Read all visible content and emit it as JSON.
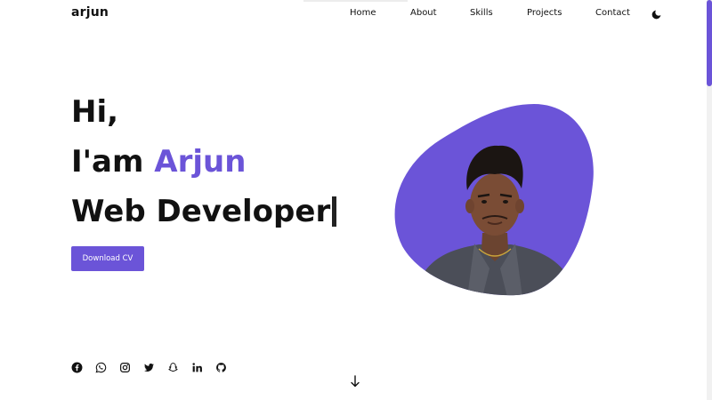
{
  "header": {
    "logo": "arjun",
    "nav": [
      "Home",
      "About",
      "Skills",
      "Projects",
      "Contact"
    ],
    "theme_icon": "moon-icon"
  },
  "hero": {
    "greeting": "Hi,",
    "intro_prefix": "I'am ",
    "name": "Arjun",
    "role": "Web Developer",
    "button_label": "Download CV"
  },
  "social_icons": [
    "facebook-icon",
    "whatsapp-icon",
    "instagram-icon",
    "twitter-icon",
    "snapchat-icon",
    "linkedin-icon",
    "github-icon"
  ],
  "scroll_icon": "arrow-down-icon",
  "colors": {
    "accent": "#6b54d8",
    "text": "#111111",
    "background": "#ffffff"
  }
}
